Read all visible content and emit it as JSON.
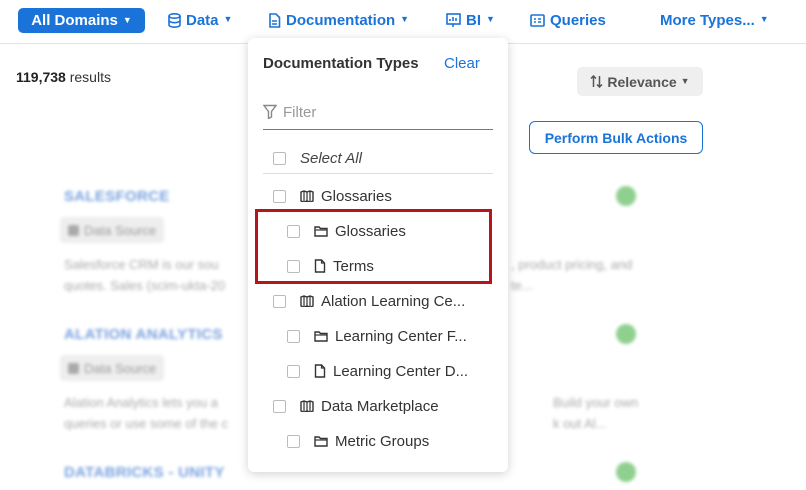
{
  "topbar": {
    "all_domains": "All Domains",
    "data": "Data",
    "documentation": "Documentation",
    "bi": "BI",
    "queries": "Queries",
    "more_types": "More Types..."
  },
  "results": {
    "count": "119,738",
    "label": "results"
  },
  "sort": {
    "label": "Relevance"
  },
  "bulk_actions": {
    "label": "Perform Bulk Actions"
  },
  "dropdown": {
    "title": "Documentation Types",
    "clear": "Clear",
    "filter_placeholder": "Filter",
    "select_all": "Select All",
    "items": [
      {
        "label": "Glossaries",
        "icon": "columns-icon",
        "level": 0
      },
      {
        "label": "Glossaries",
        "icon": "folder-icon",
        "level": 1
      },
      {
        "label": "Terms",
        "icon": "document-icon",
        "level": 1
      },
      {
        "label": "Alation Learning Ce...",
        "icon": "columns-icon",
        "level": 0
      },
      {
        "label": "Learning Center F...",
        "icon": "folder-icon",
        "level": 1
      },
      {
        "label": "Learning Center D...",
        "icon": "document-icon",
        "level": 1
      },
      {
        "label": "Data Marketplace",
        "icon": "columns-icon",
        "level": 0
      },
      {
        "label": "Metric Groups",
        "icon": "folder-icon",
        "level": 1
      }
    ]
  },
  "background_results": [
    {
      "title": "SALESFORCE",
      "badge": "Data Source",
      "desc_line1": "Salesforce CRM is our sou",
      "desc_line1_end": ", product pricing, and",
      "desc_line2": "quotes. Sales (scim-ukta-20",
      "desc_line2_end": "te..."
    },
    {
      "title": "ALATION ANALYTICS",
      "badge": "Data Source",
      "desc_line1": "Alation Analytics lets you a",
      "desc_line1_end": "Build your own",
      "desc_line2": "queries or use some of the c",
      "desc_line2_end": "k out Al..."
    },
    {
      "title": "DATABRICKS - UNITY"
    }
  ],
  "colors": {
    "accent": "#1a73d9",
    "highlight": "#b5161b"
  }
}
